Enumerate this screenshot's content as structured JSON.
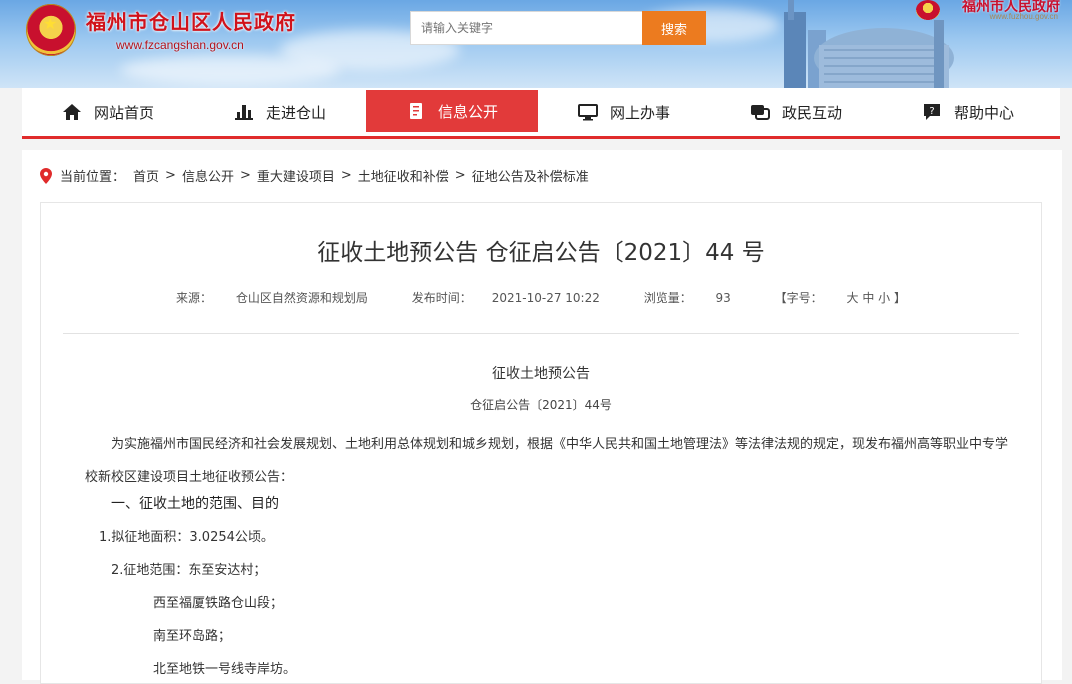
{
  "header": {
    "site_title": "福州市仓山区人民政府",
    "site_url": "www.fzcangshan.gov.cn",
    "search_placeholder": "请输入关键字",
    "search_button": "搜索",
    "right_title": "福州市人民政府",
    "right_url": "www.fuzhou.gov.cn"
  },
  "nav": {
    "items": [
      {
        "label": "网站首页",
        "icon": "home-icon"
      },
      {
        "label": "走进仓山",
        "icon": "city-icon"
      },
      {
        "label": "信息公开",
        "icon": "document-icon"
      },
      {
        "label": "网上办事",
        "icon": "monitor-icon"
      },
      {
        "label": "政民互动",
        "icon": "chat-icon"
      },
      {
        "label": "帮助中心",
        "icon": "help-icon"
      }
    ],
    "active_index": 2
  },
  "breadcrumb": {
    "prefix": "当前位置：",
    "items": [
      "首页",
      "信息公开",
      "重大建设项目",
      "土地征收和补偿",
      "征地公告及补偿标准"
    ],
    "separator": ">"
  },
  "article": {
    "title": "征收土地预公告 仓征启公告〔2021〕44 号",
    "source_label": "来源：",
    "source": "仓山区自然资源和规划局",
    "date_label": "发布时间：",
    "date": "2021-10-27 10:22",
    "views_label": "浏览量：",
    "views": "93",
    "font_label": "【字号：",
    "font_sizes": "大 中 小 】",
    "body_title": "征收土地预公告",
    "body_number": "仓征启公告〔2021〕44号",
    "paragraph": "为实施福州市国民经济和社会发展规划、土地利用总体规划和城乡规划，根据《中华人民共和国土地管理法》等法律法规的规定，现发布福州高等职业中专学校新校区建设项目土地征收预公告：",
    "section1": "一、征收土地的范围、目的",
    "item1": "1.拟征地面积：3.0254公顷。",
    "item2": "2.征地范围：东至安达村；",
    "line_south": "西至福厦铁路仓山段；",
    "line_north": "南至环岛路；",
    "line_west": "北至地铁一号线寺岸坊。"
  }
}
